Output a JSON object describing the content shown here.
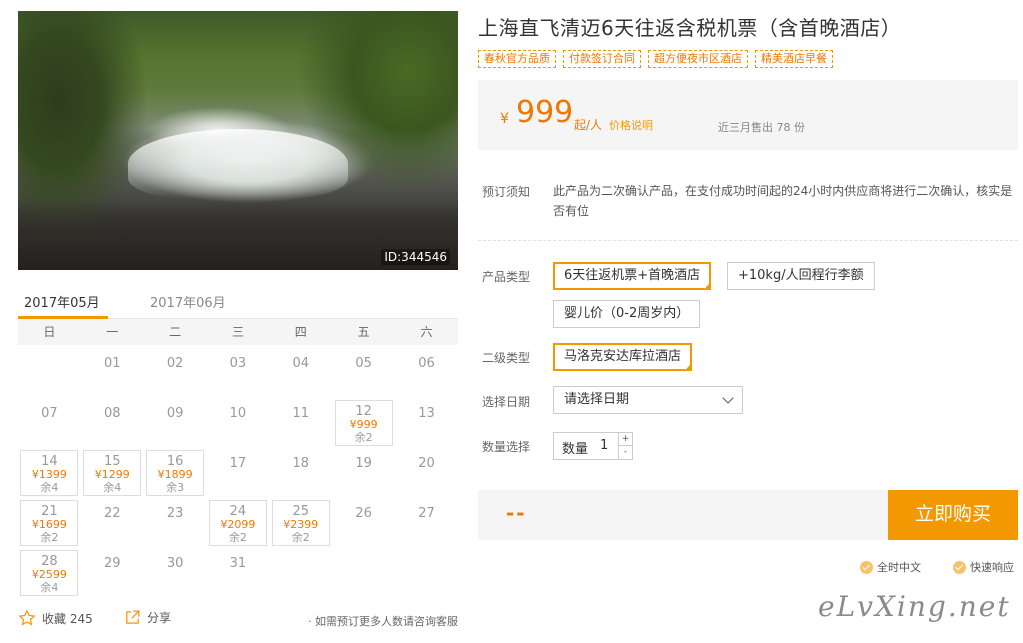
{
  "photo": {
    "id_label": "ID:344546"
  },
  "calendar": {
    "tabs": [
      {
        "label": "2017年05月",
        "active": true
      },
      {
        "label": "2017年06月",
        "active": false
      }
    ],
    "weekdays": [
      "日",
      "一",
      "二",
      "三",
      "四",
      "五",
      "六"
    ],
    "days": [
      {
        "d": "01",
        "col": 1,
        "row": 0
      },
      {
        "d": "02",
        "col": 2,
        "row": 0
      },
      {
        "d": "03",
        "col": 3,
        "row": 0
      },
      {
        "d": "04",
        "col": 4,
        "row": 0
      },
      {
        "d": "05",
        "col": 5,
        "row": 0
      },
      {
        "d": "06",
        "col": 6,
        "row": 0
      },
      {
        "d": "07",
        "col": 0,
        "row": 1
      },
      {
        "d": "08",
        "col": 1,
        "row": 1
      },
      {
        "d": "09",
        "col": 2,
        "row": 1
      },
      {
        "d": "10",
        "col": 3,
        "row": 1
      },
      {
        "d": "11",
        "col": 4,
        "row": 1
      },
      {
        "d": "12",
        "col": 5,
        "row": 1,
        "price": "¥999",
        "remain": "余2"
      },
      {
        "d": "13",
        "col": 6,
        "row": 1
      },
      {
        "d": "14",
        "col": 0,
        "row": 2,
        "price": "¥1399",
        "remain": "余4"
      },
      {
        "d": "15",
        "col": 1,
        "row": 2,
        "price": "¥1299",
        "remain": "余4"
      },
      {
        "d": "16",
        "col": 2,
        "row": 2,
        "price": "¥1899",
        "remain": "余3"
      },
      {
        "d": "17",
        "col": 3,
        "row": 2
      },
      {
        "d": "18",
        "col": 4,
        "row": 2
      },
      {
        "d": "19",
        "col": 5,
        "row": 2
      },
      {
        "d": "20",
        "col": 6,
        "row": 2
      },
      {
        "d": "21",
        "col": 0,
        "row": 3,
        "price": "¥1699",
        "remain": "余2"
      },
      {
        "d": "22",
        "col": 1,
        "row": 3
      },
      {
        "d": "23",
        "col": 2,
        "row": 3
      },
      {
        "d": "24",
        "col": 3,
        "row": 3,
        "price": "¥2099",
        "remain": "余2"
      },
      {
        "d": "25",
        "col": 4,
        "row": 3,
        "price": "¥2399",
        "remain": "余2"
      },
      {
        "d": "26",
        "col": 5,
        "row": 3
      },
      {
        "d": "27",
        "col": 6,
        "row": 3
      },
      {
        "d": "28",
        "col": 0,
        "row": 4,
        "price": "¥2599",
        "remain": "余4"
      },
      {
        "d": "29",
        "col": 1,
        "row": 4
      },
      {
        "d": "30",
        "col": 2,
        "row": 4
      },
      {
        "d": "31",
        "col": 3,
        "row": 4
      }
    ]
  },
  "footer_left": {
    "favorite_label": "收藏 245",
    "share_label": "分享",
    "note": "· 如需预订更多人数请咨询客服"
  },
  "product": {
    "title": "上海直飞清迈6天往返含税机票（含首晚酒店）",
    "tags": [
      "春秋官方品质",
      "付款签订合同",
      "超方便夜市区酒店",
      "精美酒店早餐"
    ],
    "price": {
      "currency": "¥",
      "amount": "999",
      "unit": "起/人",
      "explain_link": "价格说明",
      "sold": "近三月售出 78 份"
    },
    "notice": {
      "label": "预订须知",
      "text": "此产品为二次确认产品，在支付成功时间起的24小时内供应商将进行二次确认，核实是否有位"
    },
    "product_type": {
      "label": "产品类型",
      "options": [
        "6天往返机票+首晚酒店",
        "+10kg/人回程行李额",
        "婴儿价（0-2周岁内）"
      ]
    },
    "sub_type": {
      "label": "二级类型",
      "options": [
        "马洛克安达库拉酒店"
      ]
    },
    "date": {
      "label": "选择日期",
      "placeholder": "请选择日期"
    },
    "quantity": {
      "label": "数量选择",
      "inner_label": "数量",
      "value": "1",
      "plus": "+",
      "minus": "-"
    },
    "buy": {
      "total": "--",
      "button": "立即购买"
    },
    "assurances": [
      "全时中文",
      "快速响应"
    ]
  },
  "watermark": "eLvXing.net",
  "colors": {
    "accent": "#f39800",
    "price": "#f07800",
    "panel": "#f5f5f5"
  }
}
